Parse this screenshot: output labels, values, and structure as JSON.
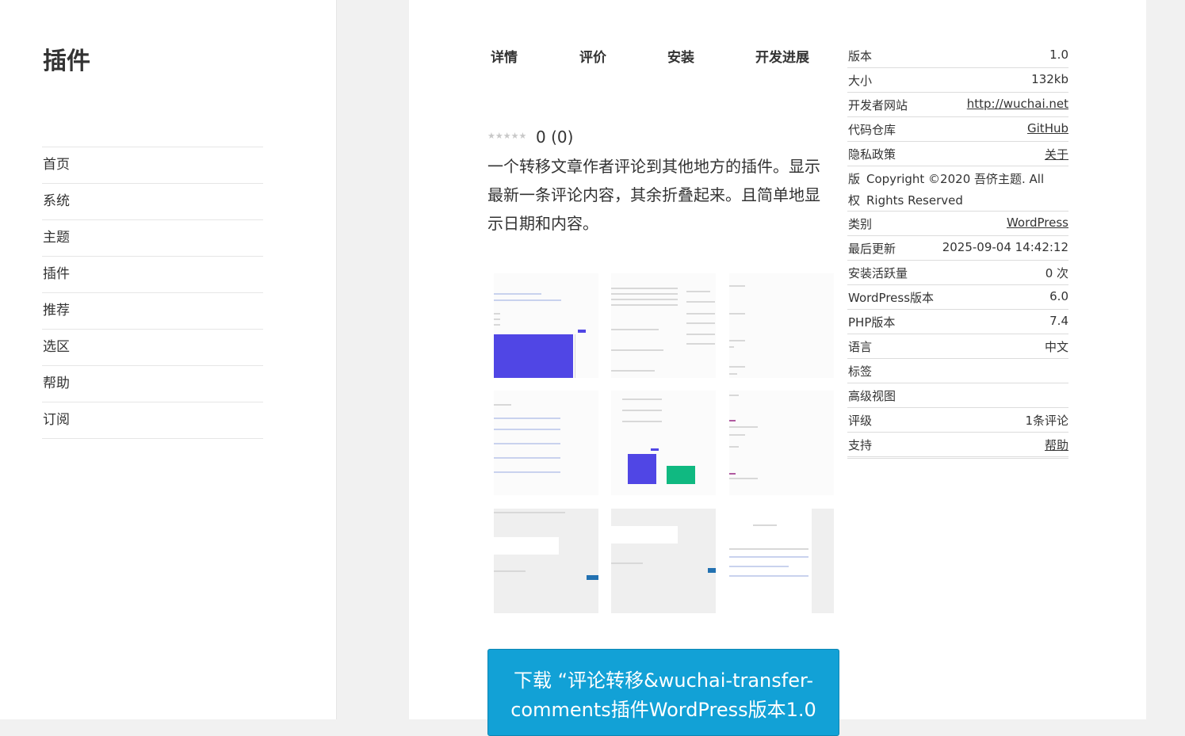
{
  "sidebar": {
    "title": "插件",
    "nav": [
      "首页",
      "系统",
      "主题",
      "插件",
      "推荐",
      "选区",
      "帮助",
      "订阅"
    ]
  },
  "tabs": [
    "详情",
    "评价",
    "安装",
    "开发进展"
  ],
  "rating": {
    "stars_filled": 0,
    "stars_total": 5,
    "text": "0 (0)"
  },
  "description": "一个转移文章作者评论到其他地方的插件。显示最新一条评论内容，其余折叠起来。且简单地显示日期和内容。",
  "download_button": "下载 “评论转移&wuchai-transfer-comments插件WordPress版本1.0",
  "meta": [
    {
      "key": "版本",
      "value": "1.0",
      "link": false
    },
    {
      "key": "大小",
      "value": "132kb",
      "link": false
    },
    {
      "key": "开发者网站",
      "value": "http://wuchai.net",
      "link": true
    },
    {
      "key": "代码仓库",
      "value": "GitHub",
      "link": true
    },
    {
      "key": "隐私政策",
      "value": "关于",
      "link": true
    },
    {
      "key": "版权",
      "value": "Copyright ©2020 吾侪主题. All Rights Reserved",
      "link": false,
      "tall": true
    },
    {
      "key": "类别",
      "value": "WordPress",
      "link": true
    },
    {
      "key": "最后更新",
      "value": "2025-09-04 14:42:12",
      "link": false
    },
    {
      "key": "安装活跃量",
      "value": "0 次",
      "link": false
    },
    {
      "key": "WordPress版本",
      "value": "6.0",
      "link": false
    },
    {
      "key": "PHP版本",
      "value": "7.4",
      "link": false
    },
    {
      "key": "语言",
      "value": "中文",
      "link": false
    },
    {
      "key": "标签",
      "value": "",
      "link": false
    },
    {
      "key": "高级视图",
      "value": "",
      "link": false
    },
    {
      "key": "评级",
      "value": "1条评论",
      "link": false
    },
    {
      "key": "支持",
      "value": "帮助",
      "link": true
    }
  ],
  "colors": {
    "download_bg": "#12a1d6",
    "chart_purple": "#5046e5",
    "chart_green": "#10b981"
  },
  "icons": {
    "rating": "star-icon"
  }
}
